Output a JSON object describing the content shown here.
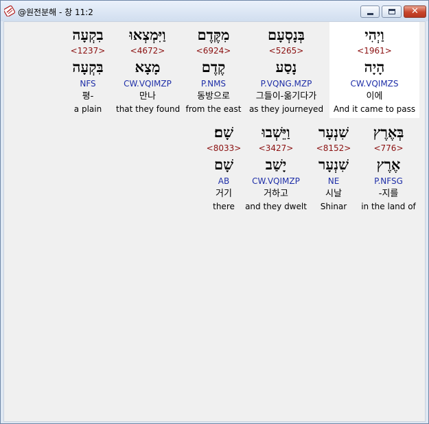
{
  "window": {
    "title": "@원전분해 - 창 11:2",
    "min_icon": "minimize-icon",
    "max_icon": "maximize-icon",
    "close_icon": "close-icon",
    "close_glyph": "✕"
  },
  "rows": [
    {
      "words": [
        {
          "surface": "וַיְהִי",
          "strongs": "<1961>",
          "lemma": "הָיָה",
          "morph": "CW.VQIMZS",
          "korean": "이에",
          "english": "And it came to pass",
          "highlight": true
        },
        {
          "surface": "בְּנָסְעָם",
          "strongs": "<5265>",
          "lemma": "נָסַע",
          "morph": "P.VQNG.MZP",
          "korean": "그들이-옮기다가",
          "english": "as they journeyed",
          "highlight": false
        },
        {
          "surface": "מִקֶּדֶם",
          "strongs": "<6924>",
          "lemma": "קֶדֶם",
          "morph": "P.NMS",
          "korean": "동방으로",
          "english": "from the east",
          "highlight": false
        },
        {
          "surface": "וַיִּמְצְאוּ",
          "strongs": "<4672>",
          "lemma": "מָצָא",
          "morph": "CW.VQIMZP",
          "korean": "만나",
          "english": "that they found",
          "highlight": false
        },
        {
          "surface": "בִקְעָה",
          "strongs": "<1237>",
          "lemma": "בִּקְעָה",
          "morph": "NFS",
          "korean": "평-",
          "english": "a plain",
          "highlight": false
        }
      ]
    },
    {
      "words": [
        {
          "surface": "בְּאֶרֶץ",
          "strongs": "<776>",
          "lemma": "אֶרֶץ",
          "morph": "P.NFSG",
          "korean": "-지를",
          "english": "in the land of",
          "highlight": false
        },
        {
          "surface": "שִׁנְעָר",
          "strongs": "<8152>",
          "lemma": "שִׁנְעָר",
          "morph": "NE",
          "korean": "시날",
          "english": "Shinar",
          "highlight": false
        },
        {
          "surface": "וַיֵּשְׁבוּ",
          "strongs": "<3427>",
          "lemma": "יָשַׁב",
          "morph": "CW.VQIMZP",
          "korean": "거하고",
          "english": "and they dwelt",
          "highlight": false
        },
        {
          "surface": "שָׁם׃",
          "strongs": "<8033>",
          "lemma": "שָׁם",
          "morph": "AB",
          "korean": "거기",
          "english": "there",
          "highlight": false
        }
      ]
    }
  ]
}
